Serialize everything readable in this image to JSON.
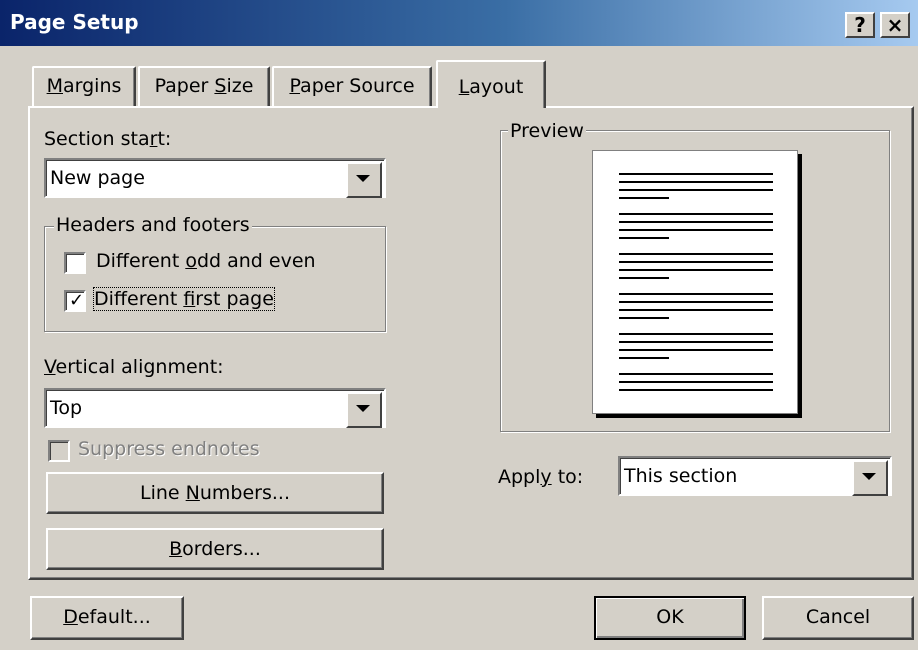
{
  "window": {
    "title": "Page Setup",
    "help_label": "?",
    "close_label": "×"
  },
  "tabs": [
    {
      "label": "Margins",
      "accel": "M",
      "rest": "argins"
    },
    {
      "label": "Paper Size",
      "pre": "Paper ",
      "accel": "S",
      "rest": "ize"
    },
    {
      "label": "Paper Source",
      "accel": "P",
      "rest": "aper Source"
    },
    {
      "label": "Layout",
      "accel": "L",
      "rest": "ayout",
      "active": true
    }
  ],
  "section_start": {
    "label_pre": "Section sta",
    "accel": "r",
    "label_post": "t:",
    "value": "New page"
  },
  "headers_footers": {
    "legend": "Headers and footers",
    "odd_even": {
      "pre": "Different ",
      "accel": "o",
      "post": "dd and even",
      "checked": false
    },
    "first_page": {
      "pre": "Different ",
      "accel": "f",
      "post": "irst page",
      "checked": true
    }
  },
  "vertical_alignment": {
    "accel": "V",
    "label_post": "ertical alignment:",
    "value": "Top"
  },
  "suppress_endnotes": {
    "label": "Suppress endnotes",
    "checked": false,
    "disabled": true
  },
  "line_numbers_button": {
    "pre": "Line ",
    "accel": "N",
    "post": "umbers..."
  },
  "borders_button": {
    "accel": "B",
    "post": "orders..."
  },
  "preview": {
    "legend": "Preview"
  },
  "apply_to": {
    "pre": "Appl",
    "accel": "y",
    "post": " to:",
    "value": "This section"
  },
  "default_button": {
    "accel": "D",
    "post": "efault..."
  },
  "ok_button": {
    "label": "OK"
  },
  "cancel_button": {
    "label": "Cancel"
  }
}
